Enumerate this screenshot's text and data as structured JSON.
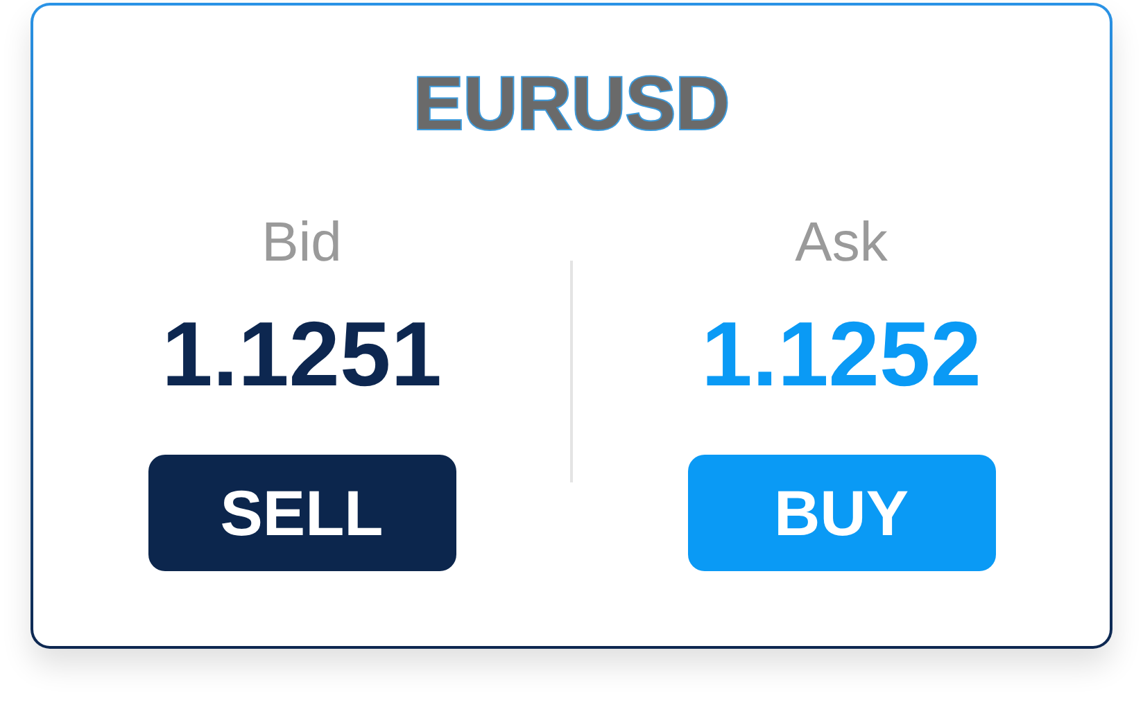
{
  "symbol": "EURUSD",
  "quotes": [
    {
      "kind": "sell",
      "label": "Bid",
      "price": "1.1251",
      "action": "SELL"
    },
    {
      "kind": "buy",
      "label": "Ask",
      "price": "1.1252",
      "action": "BUY"
    }
  ]
}
